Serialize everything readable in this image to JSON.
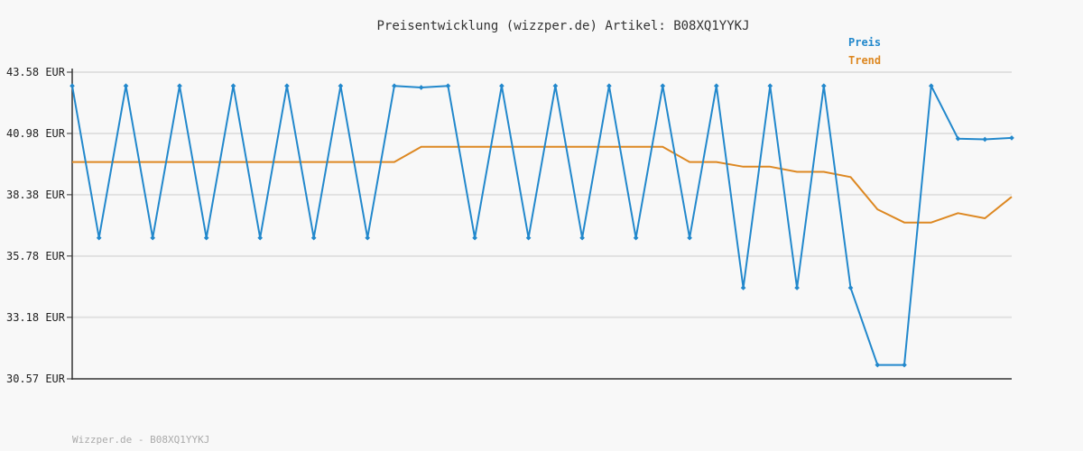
{
  "chart_data": {
    "type": "line",
    "title": "Preisentwicklung (wizzper.de) Artikel: B08XQ1YYKJ",
    "footer": "Wizzper.de - B08XQ1YYKJ",
    "ylim": [
      30.57,
      43.58
    ],
    "y_ticks": [
      "43.58 EUR",
      "40.98 EUR",
      "38.38 EUR",
      "35.78 EUR",
      "33.18 EUR",
      "30.57 EUR"
    ],
    "y_tick_values": [
      43.58,
      40.98,
      38.38,
      35.78,
      33.18,
      30.57
    ],
    "grid": true,
    "legend_position": "top-right",
    "colors": {
      "preis": "#2288cc",
      "trend": "#dd8822"
    },
    "series": [
      {
        "name": "Preis",
        "values": [
          43.0,
          36.55,
          43.0,
          36.55,
          43.0,
          36.55,
          43.0,
          36.55,
          43.0,
          36.55,
          43.0,
          36.55,
          43.0,
          42.93,
          43.0,
          36.55,
          43.0,
          36.55,
          43.0,
          36.55,
          43.0,
          36.55,
          43.0,
          36.55,
          43.0,
          34.43,
          43.0,
          34.43,
          43.0,
          34.43,
          31.16,
          31.16,
          43.0,
          40.76,
          40.73,
          40.79
        ]
      },
      {
        "name": "Trend",
        "values": [
          39.77,
          39.77,
          39.77,
          39.77,
          39.77,
          39.77,
          39.77,
          39.77,
          39.77,
          39.77,
          39.77,
          39.77,
          39.77,
          40.41,
          40.41,
          40.41,
          40.41,
          40.41,
          40.41,
          40.41,
          40.41,
          40.41,
          40.41,
          39.77,
          39.77,
          39.57,
          39.57,
          39.35,
          39.35,
          39.13,
          37.76,
          37.2,
          37.2,
          37.6,
          37.38,
          38.29
        ]
      }
    ]
  }
}
